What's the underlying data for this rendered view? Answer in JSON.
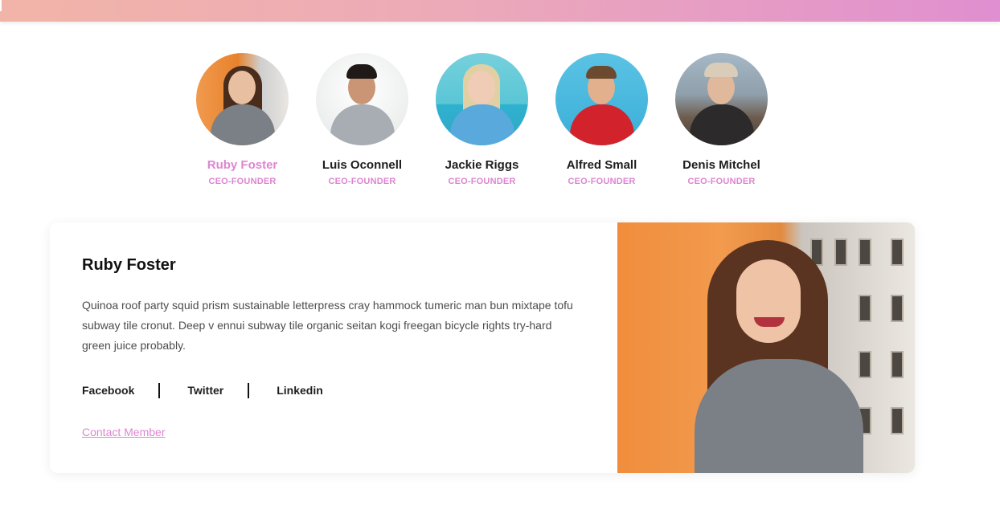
{
  "team": [
    {
      "name": "Ruby Foster",
      "role": "CEO-FOUNDER",
      "active": true
    },
    {
      "name": "Luis Oconnell",
      "role": "CEO-FOUNDER",
      "active": false
    },
    {
      "name": "Jackie Riggs",
      "role": "CEO-FOUNDER",
      "active": false
    },
    {
      "name": "Alfred Small",
      "role": "CEO-FOUNDER",
      "active": false
    },
    {
      "name": "Denis Mitchel",
      "role": "CEO-FOUNDER",
      "active": false
    }
  ],
  "profile": {
    "name": "Ruby Foster",
    "bio": "Quinoa roof party squid prism sustainable letterpress cray hammock tumeric man bun mixtape tofu subway tile cronut. Deep v ennui subway tile organic seitan kogi freegan bicycle rights try-hard green juice probably.",
    "social": {
      "facebook": "Facebook",
      "twitter": "Twitter",
      "linkedin": "Linkedin"
    },
    "contact_label": "Contact Member"
  },
  "colors": {
    "accent": "#dd85d1",
    "header_gradient_start": "#f2b4a8",
    "header_gradient_end": "#e08fd0"
  }
}
